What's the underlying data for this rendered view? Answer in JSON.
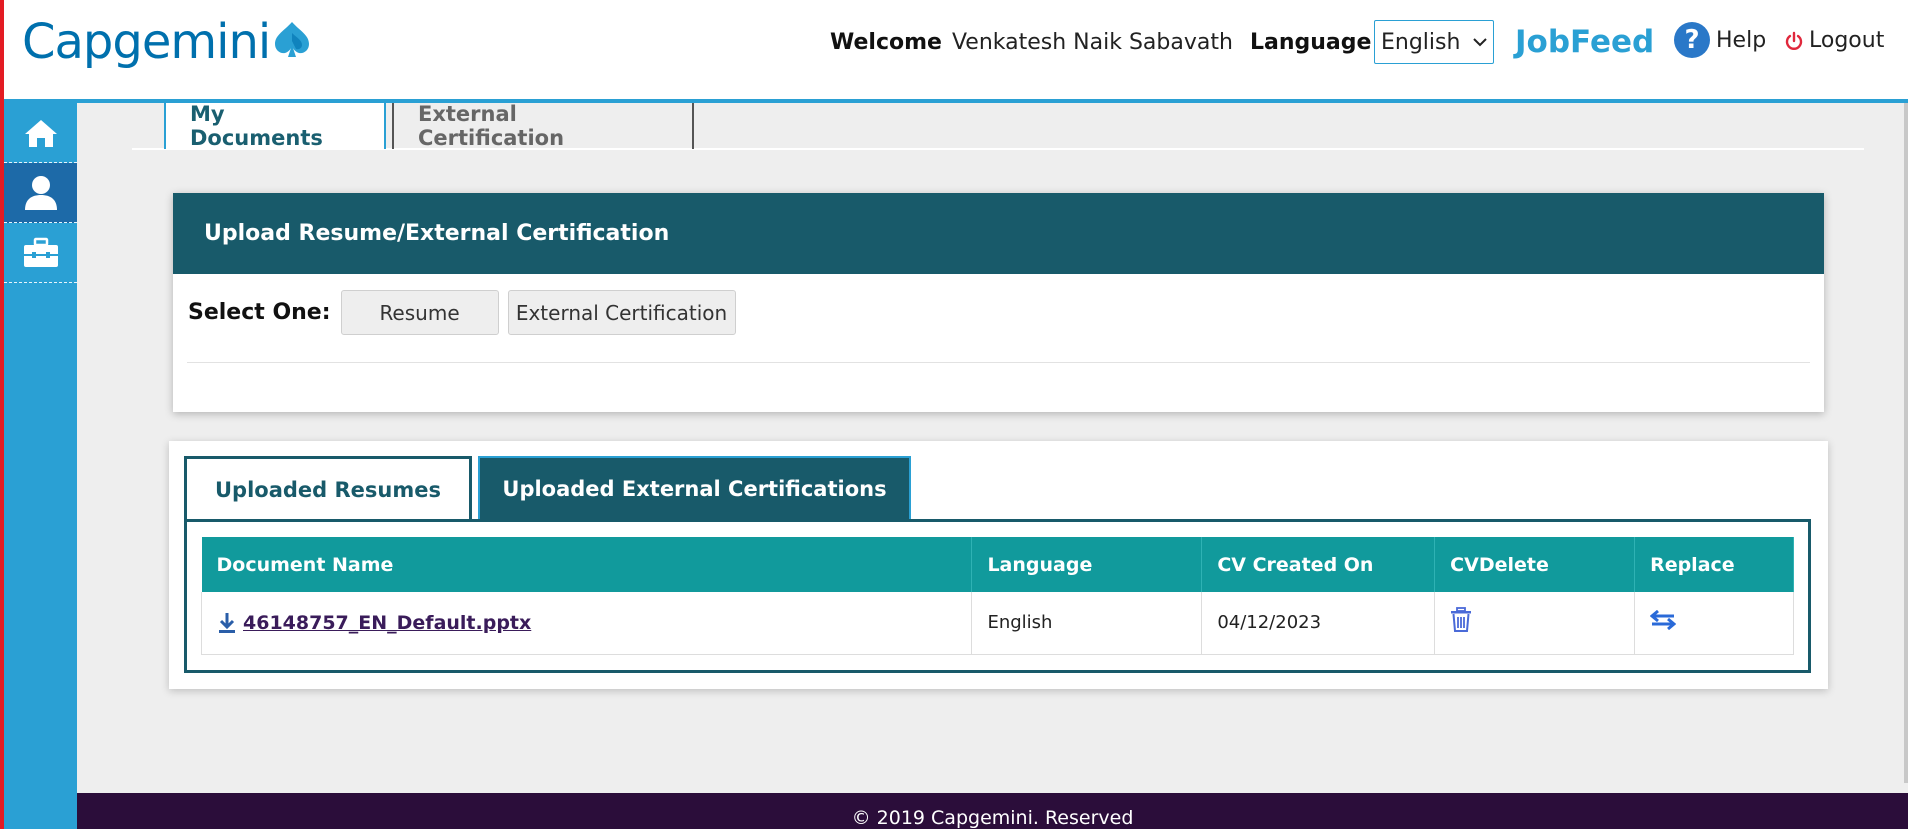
{
  "brand": {
    "logo_text": "Capgemini"
  },
  "header": {
    "welcome_label": "Welcome",
    "user_name": "Venkatesh Naik Sabavath",
    "language_label": "Language",
    "language_value": "English",
    "jobfeed": "JobFeed",
    "help": "Help",
    "logout": "Logout"
  },
  "sidebar": {
    "items": [
      {
        "icon": "home-icon",
        "active": false
      },
      {
        "icon": "user-icon",
        "active": true
      },
      {
        "icon": "briefcase-icon",
        "active": false
      }
    ]
  },
  "top_tabs": [
    {
      "label": "My Documents",
      "active": true
    },
    {
      "label": "External Certification",
      "active": false
    }
  ],
  "upload": {
    "title": "Upload Resume/External Certification",
    "select_label": "Select One:",
    "options": [
      "Resume",
      "External Certification"
    ]
  },
  "uploaded": {
    "tabs": [
      {
        "label": "Uploaded Resumes",
        "active": false
      },
      {
        "label": "Uploaded External Certifications",
        "active": true
      }
    ],
    "columns": [
      "Document Name",
      "Language",
      "CV Created On",
      "CVDelete",
      "Replace"
    ],
    "rows": [
      {
        "document": "46148757_EN_Default.pptx",
        "language": "English",
        "created_on": "04/12/2023"
      }
    ]
  },
  "footer": {
    "text": "© 2019 Capgemini. Reserved"
  },
  "colors": {
    "accent": "#2aa0d4",
    "dark_teal": "#185a6a",
    "table_header": "#119a9c",
    "footer_bg": "#2b0d3a",
    "brand_blue": "#0070ad"
  }
}
